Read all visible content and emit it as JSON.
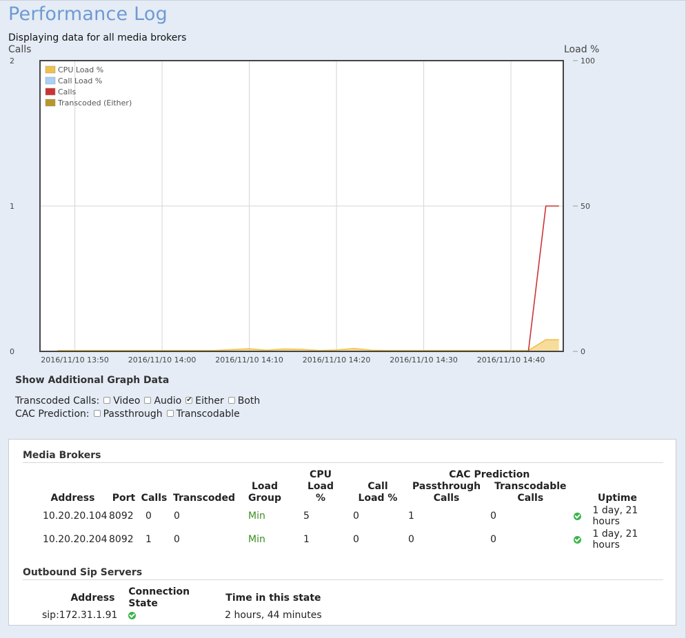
{
  "page": {
    "title": "Performance Log",
    "subtitle": "Displaying data for all media brokers"
  },
  "chart_data": {
    "type": "line",
    "left_axis_label": "Calls",
    "right_axis_label": "Load %",
    "left_ylim": [
      0,
      2
    ],
    "right_ylim": [
      0,
      100
    ],
    "left_ticks": [
      "0",
      "1",
      "2"
    ],
    "right_ticks": [
      "0",
      "50",
      "100"
    ],
    "xlim": [
      "2016/11/10 13:46",
      "2016/11/10 14:46"
    ],
    "x_tick_labels": [
      "2016/11/10 13:50",
      "2016/11/10 14:00",
      "2016/11/10 14:10",
      "2016/11/10 14:20",
      "2016/11/10 14:30",
      "2016/11/10 14:40"
    ],
    "x_ticks_minutes": [
      4,
      14,
      24,
      34,
      44,
      54
    ],
    "legend_position": "top-left",
    "grid": true,
    "series": [
      {
        "name": "CPU Load %",
        "axis": "right",
        "color": "#f0c14b",
        "fill": true,
        "points": [
          [
            2,
            0.3
          ],
          [
            20,
            0.3
          ],
          [
            24,
            0.9
          ],
          [
            26,
            0.4
          ],
          [
            28,
            0.8
          ],
          [
            30,
            0.7
          ],
          [
            32,
            0.3
          ],
          [
            34,
            0.5
          ],
          [
            36,
            1.0
          ],
          [
            38,
            0.4
          ],
          [
            40,
            0.3
          ],
          [
            56,
            0.3
          ],
          [
            58,
            4
          ],
          [
            59.5,
            4
          ]
        ]
      },
      {
        "name": "Call Load %",
        "axis": "right",
        "color": "#a9d1f5",
        "fill": true,
        "points": [
          [
            2,
            0
          ],
          [
            59.5,
            0
          ]
        ]
      },
      {
        "name": "Calls",
        "axis": "left",
        "color": "#cc3333",
        "fill": false,
        "points": [
          [
            2,
            0
          ],
          [
            56,
            0
          ],
          [
            58,
            1
          ],
          [
            59.5,
            1
          ]
        ]
      },
      {
        "name": "Transcoded (Either)",
        "axis": "left",
        "color": "#b8962c",
        "fill": false,
        "points": [
          [
            2,
            0
          ],
          [
            59.5,
            0
          ]
        ]
      }
    ]
  },
  "graph_options": {
    "heading": "Show Additional Graph Data",
    "transcoded": {
      "label": "Transcoded Calls:",
      "options": [
        {
          "label": "Video",
          "checked": false
        },
        {
          "label": "Audio",
          "checked": false
        },
        {
          "label": "Either",
          "checked": true
        },
        {
          "label": "Both",
          "checked": false
        }
      ]
    },
    "cac": {
      "label": "CAC Prediction:",
      "options": [
        {
          "label": "Passthrough",
          "checked": false
        },
        {
          "label": "Transcodable",
          "checked": false
        }
      ]
    }
  },
  "media_brokers": {
    "title": "Media Brokers",
    "cac_group_header": "CAC Prediction",
    "headers": {
      "address": "Address",
      "port": "Port",
      "calls": "Calls",
      "transcoded": "Transcoded",
      "load_group": "Load Group",
      "cpu_load": "CPU Load %",
      "call_load": "Call Load %",
      "passthrough": "Passthrough Calls",
      "transcodable": "Transcodable Calls",
      "uptime": "Uptime"
    },
    "rows": [
      {
        "address": "10.20.20.104",
        "port": "8092",
        "calls": "0",
        "transcoded": "0",
        "load_group": "Min",
        "cpu_load": "5",
        "call_load": "0",
        "passthrough": "1",
        "transcodable": "0",
        "status_icon": "check-circle-icon",
        "uptime": "1 day, 21 hours"
      },
      {
        "address": "10.20.20.204",
        "port": "8092",
        "calls": "1",
        "transcoded": "0",
        "load_group": "Min",
        "cpu_load": "1",
        "call_load": "0",
        "passthrough": "0",
        "transcodable": "0",
        "status_icon": "check-circle-icon",
        "uptime": "1 day, 21 hours"
      }
    ]
  },
  "outbound_sip": {
    "title": "Outbound Sip Servers",
    "headers": {
      "address": "Address",
      "state": "Connection State",
      "time": "Time in this state"
    },
    "rows": [
      {
        "address": "sip:172.31.1.91",
        "state_icon": "check-circle-icon",
        "time": "2 hours, 44 minutes"
      }
    ]
  }
}
